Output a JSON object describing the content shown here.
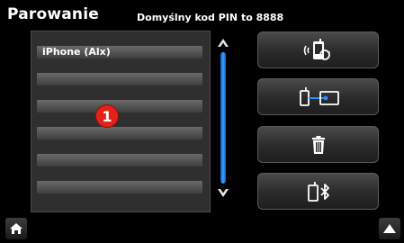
{
  "header": {
    "title": "Parowanie",
    "pin_hint": "Domyślny kod PIN to 8888"
  },
  "device_list": {
    "rows": [
      {
        "label": "iPhone (Alx)"
      },
      {
        "label": ""
      },
      {
        "label": ""
      },
      {
        "label": ""
      },
      {
        "label": ""
      },
      {
        "label": ""
      }
    ],
    "callout_badge": "1"
  },
  "scrollbar": {
    "up_icon": "chevron-up-icon",
    "down_icon": "chevron-down-icon",
    "color": "#1f7fe8"
  },
  "actions": [
    {
      "name": "search-pair-device",
      "icon": "phone-search-icon"
    },
    {
      "name": "connect-device",
      "icon": "phone-connect-icon"
    },
    {
      "name": "delete-device",
      "icon": "trash-icon"
    },
    {
      "name": "bluetooth-device",
      "icon": "phone-bluetooth-icon"
    }
  ],
  "footer": {
    "home_icon": "home-icon",
    "up_icon": "arrow-up-icon"
  },
  "colors": {
    "background": "#000000",
    "badge": "#e2231a",
    "accent_blue": "#1f7fe8"
  }
}
